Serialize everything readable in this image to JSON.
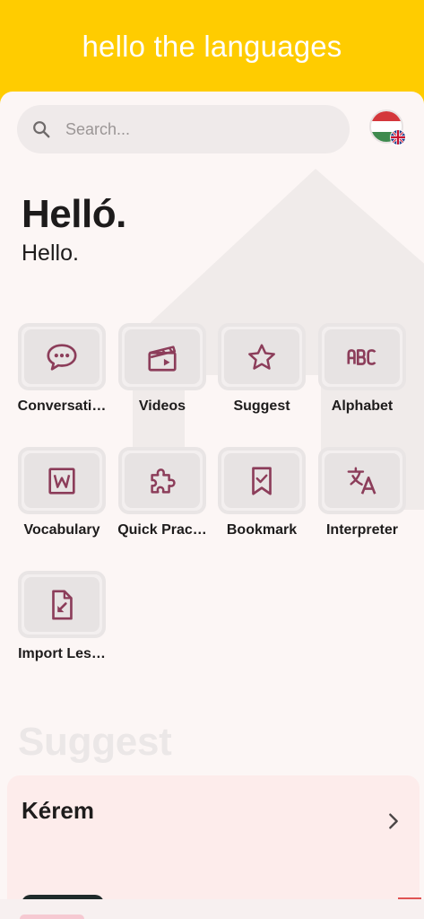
{
  "header": {
    "title": "hello the languages"
  },
  "search": {
    "placeholder": "Search..."
  },
  "greeting": {
    "native": "Helló.",
    "translation": "Hello."
  },
  "menu": [
    {
      "label": "Conversati…",
      "icon": "chat-bubble-icon"
    },
    {
      "label": "Videos",
      "icon": "clapperboard-icon"
    },
    {
      "label": "Suggest",
      "icon": "star-icon"
    },
    {
      "label": "Alphabet",
      "icon": "abc-icon"
    },
    {
      "label": "Vocabulary",
      "icon": "word-document-icon"
    },
    {
      "label": "Quick Prac…",
      "icon": "puzzle-icon"
    },
    {
      "label": "Bookmark",
      "icon": "bookmark-check-icon"
    },
    {
      "label": "Interpreter",
      "icon": "translate-icon"
    },
    {
      "label": "Import Les…",
      "icon": "file-import-icon"
    }
  ],
  "suggest_section": {
    "title": "Suggest",
    "card": {
      "word": "Kérem"
    }
  },
  "colors": {
    "brand": "#ffcc00",
    "icon": "#8c3d5a",
    "background": "#fcf6f5",
    "card": "#fdeceb"
  }
}
